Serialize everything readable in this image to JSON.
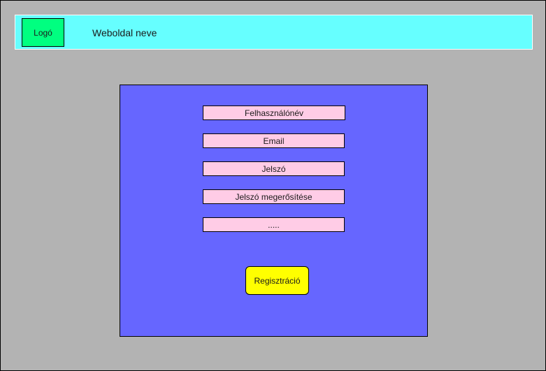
{
  "header": {
    "logo_label": "Logó",
    "site_name": "Weboldal neve"
  },
  "form": {
    "fields": [
      {
        "label": "Felhasználónév"
      },
      {
        "label": "Email"
      },
      {
        "label": "Jelszó"
      },
      {
        "label": "Jelszó megerősítése"
      },
      {
        "label": "....."
      }
    ],
    "submit_label": "Regisztráció"
  },
  "colors": {
    "background": "#b3b3b3",
    "header": "#66ffff",
    "logo": "#00ff80",
    "panel": "#6666ff",
    "field": "#ffcce6",
    "button": "#ffff00"
  }
}
